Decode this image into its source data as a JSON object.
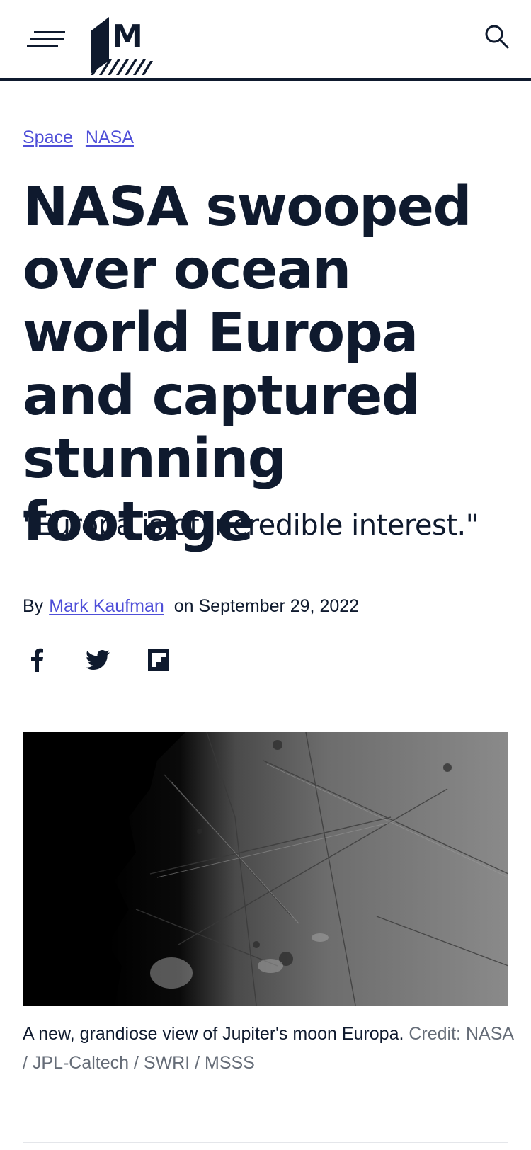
{
  "header": {
    "menu_icon": "hamburger-menu-icon",
    "logo_letter": "M",
    "search_icon": "search-icon"
  },
  "topics": [
    {
      "label": "Space"
    },
    {
      "label": "NASA"
    }
  ],
  "article": {
    "headline": "NASA swooped over ocean world Europa and captured stunning footage",
    "subheadline": "\"Europa is of incredible interest.\"",
    "byline_prefix": "By",
    "author": "Mark Kaufman",
    "date_text": "on September 29, 2022"
  },
  "share": {
    "facebook_icon": "facebook-icon",
    "twitter_icon": "twitter-icon",
    "flipboard_icon": "flipboard-icon"
  },
  "hero_image": {
    "caption": "A new, grandiose view of Jupiter's moon Europa.",
    "credit_label": "Credit:",
    "credit": "NASA / JPL-Caltech / SWRI / MSSS"
  },
  "colors": {
    "ink": "#0f1a2e",
    "link": "#4f4fd8",
    "muted": "#666d78"
  }
}
